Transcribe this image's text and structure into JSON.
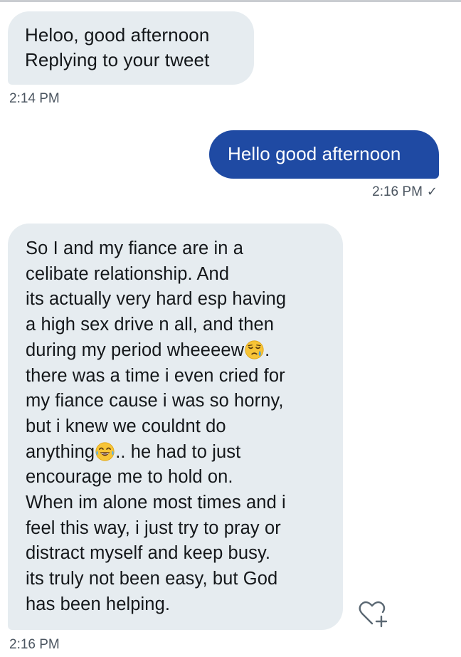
{
  "conversation": {
    "messages": [
      {
        "direction": "received",
        "lines": [
          "Heloo, good afternoon",
          "Replying to your tweet"
        ],
        "time": "2:14 PM"
      },
      {
        "direction": "sent",
        "lines": [
          "Hello good afternoon"
        ],
        "time": "2:16 PM",
        "status_icon": "checkmark-icon"
      },
      {
        "direction": "received",
        "lines": [
          "So I and my fiance are in a",
          "celibate relationship. And",
          "its actually very hard esp having",
          "a high sex drive n all, and then",
          "during my period wheeeew",
          ".",
          "there was a time i even cried for",
          "my fiance cause i was so horny,",
          "but i knew we couldnt do",
          "anything",
          ".. he had to just",
          "encourage me to hold on.",
          "When im alone most times and i",
          "feel this way, i just try to pray or",
          "distract myself and keep busy.",
          "its truly  not been easy, but God",
          "has been helping."
        ],
        "emojis": [
          "sleepy-face-emoji",
          "tears-of-joy-emoji"
        ],
        "time": "2:16 PM",
        "action_icon": "heart-plus-icon"
      }
    ]
  },
  "colors": {
    "received_bubble": "#e6ecf0",
    "sent_bubble": "#1f4aa3",
    "timestamp": "#4b5560"
  }
}
